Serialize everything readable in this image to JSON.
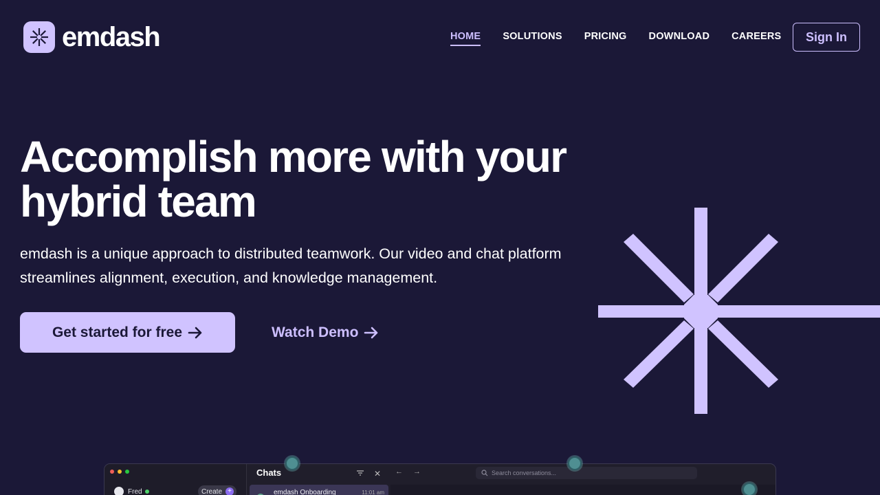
{
  "brand": {
    "name": "emdash",
    "accent": "#d0c3ff",
    "background": "#1b1837",
    "logo_icon": "asterisk-icon"
  },
  "nav": {
    "items": [
      {
        "label": "HOME",
        "active": true
      },
      {
        "label": "SOLUTIONS",
        "active": false
      },
      {
        "label": "PRICING",
        "active": false
      },
      {
        "label": "DOWNLOAD",
        "active": false
      },
      {
        "label": "CAREERS",
        "active": false
      }
    ],
    "sign_in": "Sign In"
  },
  "hero": {
    "title": "Accomplish more with your hybrid team",
    "subtitle": "emdash is a unique approach to distributed teamwork. Our video and chat platform streamlines alignment, execution, and knowledge management.",
    "primary_cta": "Get started for free",
    "secondary_cta": "Watch Demo",
    "arrow_icon": "arrow-right-icon",
    "illustration_icon": "asterisk-icon"
  },
  "app_preview": {
    "user_name": "Fred",
    "create_label": "Create",
    "chats_title": "Chats",
    "search_placeholder": "Search conversations...",
    "chat_items": [
      {
        "name": "emdash Onboarding",
        "time": "11:01 am"
      }
    ],
    "nav_arrows": "← →"
  }
}
